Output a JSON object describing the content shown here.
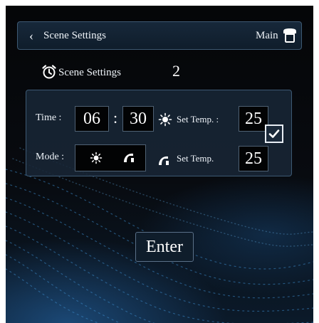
{
  "header": {
    "title": "Scene Settings",
    "main_label": "Main"
  },
  "scene": {
    "label": "Scene Settings",
    "number": "2"
  },
  "schedule": {
    "time_label": "Time :",
    "hour": "06",
    "separator": ":",
    "minute": "30",
    "set_temp_heat_label": "Set Temp. :",
    "set_temp_heat_value": "25",
    "mode_label": "Mode :",
    "set_temp_cool_label": "Set Temp.",
    "set_temp_cool_value": "25",
    "enabled": true
  },
  "actions": {
    "enter_label": "Enter"
  },
  "icons": {
    "back": "chevron-left-icon",
    "home": "home-icon",
    "alarm": "alarm-clock-icon",
    "heat": "sun-icon",
    "cool": "fan-icon",
    "check": "checkmark-icon"
  },
  "colors": {
    "background": "#050608",
    "accent_blue": "#286eb4",
    "text": "#eef3f8",
    "border": "#3d5973"
  }
}
